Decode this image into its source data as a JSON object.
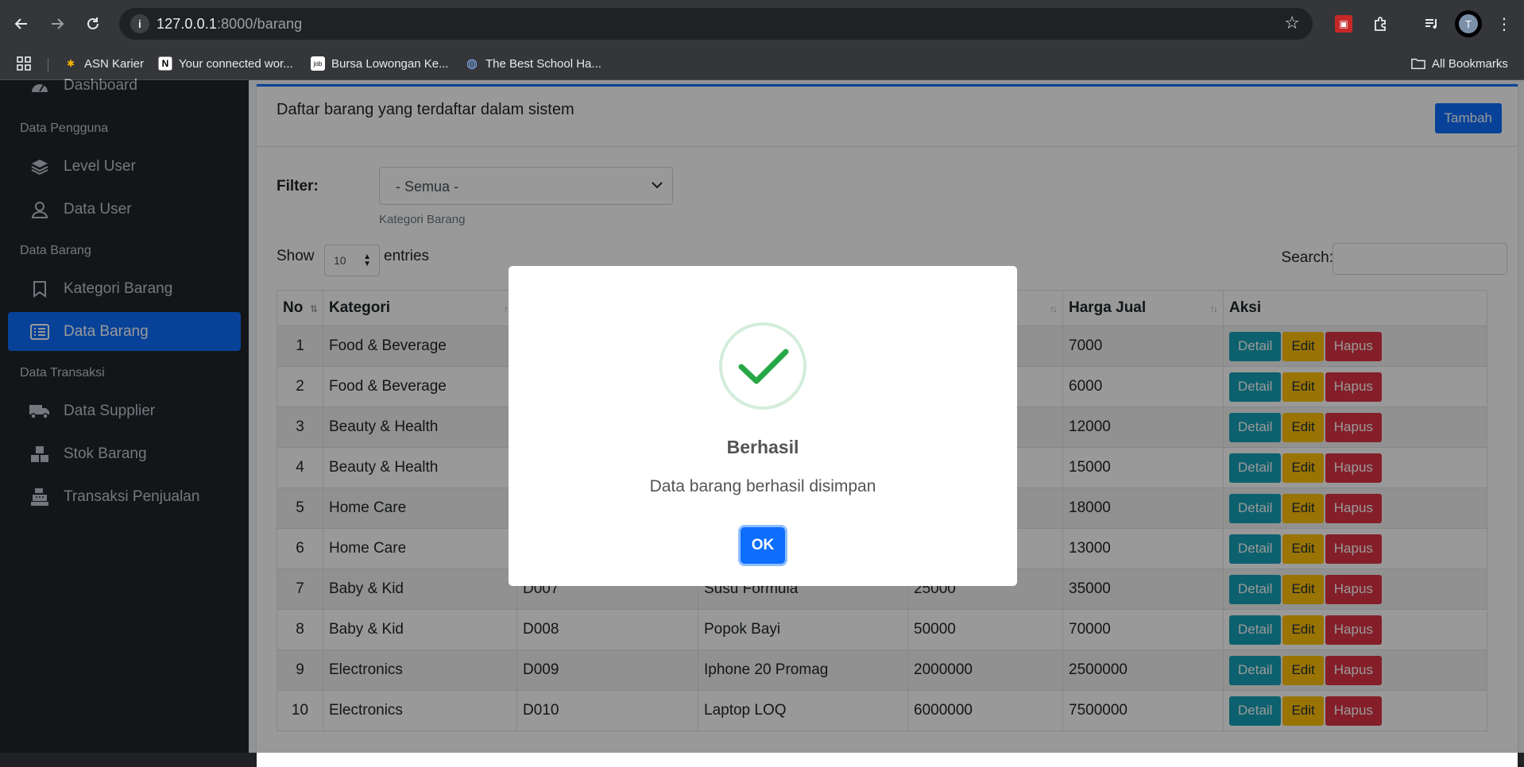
{
  "browser": {
    "url_host": "127.0.0.1",
    "url_rest": ":8000/barang",
    "bookmarks": [
      {
        "label": "ASN Karier"
      },
      {
        "label": "Your connected wor..."
      },
      {
        "label": "Bursa Lowongan Ke..."
      },
      {
        "label": "The Best School Ha..."
      }
    ],
    "all_bookmarks": "All Bookmarks",
    "avatar_letter": "T"
  },
  "sidebar": {
    "dashboard": "Dashboard",
    "sections": {
      "pengguna": "Data Pengguna",
      "barang": "Data Barang",
      "transaksi": "Data Transaksi"
    },
    "items": {
      "level_user": "Level User",
      "data_user": "Data User",
      "kategori_barang": "Kategori Barang",
      "data_barang": "Data Barang",
      "data_supplier": "Data Supplier",
      "stok_barang": "Stok Barang",
      "transaksi_penjualan": "Transaksi Penjualan"
    }
  },
  "main": {
    "title": "Daftar barang yang terdaftar dalam sistem",
    "add_button": "Tambah",
    "filter_label": "Filter:",
    "filter_value": "- Semua -",
    "filter_help": "Kategori Barang",
    "show_label": "Show",
    "entries_value": "10",
    "entries_label": "entries",
    "search_label": "Search:",
    "columns": [
      "No",
      "Kategori",
      "",
      "",
      "",
      "Harga Jual",
      "Aksi"
    ],
    "actions": {
      "detail": "Detail",
      "edit": "Edit",
      "hapus": "Hapus"
    },
    "rows": [
      {
        "no": "1",
        "kategori": "Food & Beverage",
        "kode": "",
        "nama": "",
        "beli": "",
        "jual": "7000"
      },
      {
        "no": "2",
        "kategori": "Food & Beverage",
        "kode": "",
        "nama": "",
        "beli": "",
        "jual": "6000"
      },
      {
        "no": "3",
        "kategori": "Beauty & Health",
        "kode": "",
        "nama": "",
        "beli": "",
        "jual": "12000"
      },
      {
        "no": "4",
        "kategori": "Beauty & Health",
        "kode": "",
        "nama": "",
        "beli": "",
        "jual": "15000"
      },
      {
        "no": "5",
        "kategori": "Home Care",
        "kode": "",
        "nama": "",
        "beli": "",
        "jual": "18000"
      },
      {
        "no": "6",
        "kategori": "Home Care",
        "kode": "",
        "nama": "",
        "beli": "",
        "jual": "13000"
      },
      {
        "no": "7",
        "kategori": "Baby & Kid",
        "kode": "D007",
        "nama": "Susu Formula",
        "beli": "25000",
        "jual": "35000"
      },
      {
        "no": "8",
        "kategori": "Baby & Kid",
        "kode": "D008",
        "nama": "Popok Bayi",
        "beli": "50000",
        "jual": "70000"
      },
      {
        "no": "9",
        "kategori": "Electronics",
        "kode": "D009",
        "nama": "Iphone 20 Promag",
        "beli": "2000000",
        "jual": "2500000"
      },
      {
        "no": "10",
        "kategori": "Electronics",
        "kode": "D010",
        "nama": "Laptop LOQ",
        "beli": "6000000",
        "jual": "7500000"
      }
    ]
  },
  "modal": {
    "title": "Berhasil",
    "text": "Data barang berhasil disimpan",
    "ok": "OK"
  },
  "colors": {
    "primary": "#0d6efd",
    "success": "#28a745",
    "info": "#17a2b8",
    "warning": "#ffc107",
    "danger": "#dc3545"
  }
}
